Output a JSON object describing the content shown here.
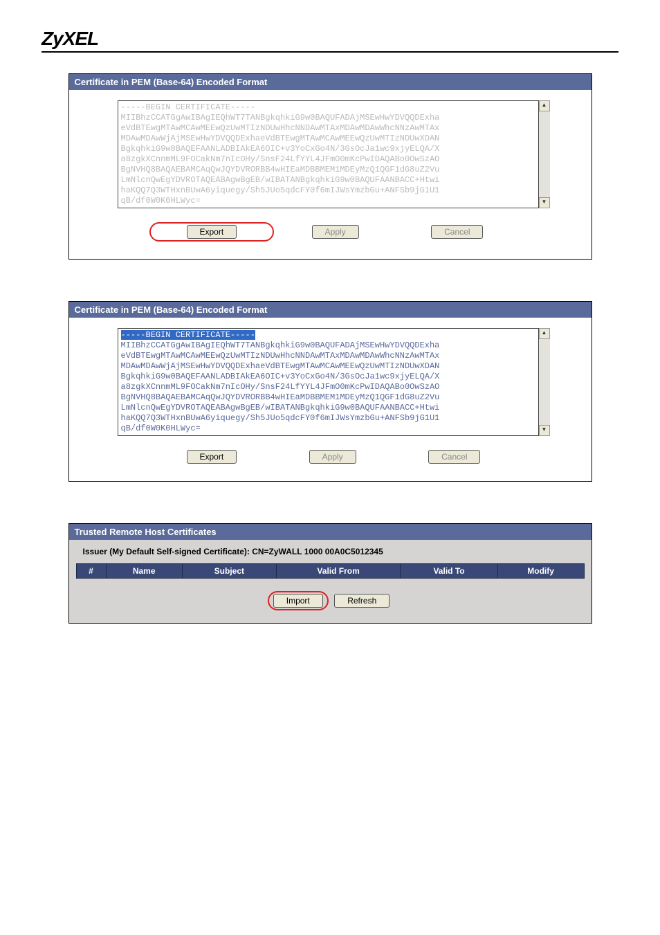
{
  "brand": "ZyXEL",
  "panel1": {
    "header": "Certificate in PEM (Base-64) Encoded Format",
    "pem_first_line": "-----BEGIN CERTIFICATE-----",
    "pem_rest": "MIIBhzCCATGgAwIBAgIEQhWT7TANBgkqhkiG9w0BAQUFADAjMSEwHwYDVQQDExha\neVdBTEwgMTAwMCAwMEEwQzUwMTIzNDUwHhcNNDAwMTAxMDAwMDAwWhcNNzAwMTAx\nMDAwMDAwWjAjMSEwHwYDVQQDExhaeVdBTEwgMTAwMCAwMEEwQzUwMTIzNDUwXDAN\nBgkqhkiG9w0BAQEFAANLADBIAkEA6OIC+v3YoCxGo4N/3GsOcJa1wc9xjyELQA/X\na8zgkXCnnmML9FOCakNm7nIcOHy/SnsF24LfYYL4JFmO0mKcPwIDAQABo0OwSzAO\nBgNVHQ8BAQAEBAMCAqQwJQYDVRORBB4wHIEaMDBBMEM1MDEyMzQ1QGF1dG8uZ2Vu\nLmNlcnQwEgYDVROTAQEABAgwBgEB/wIBATANBgkqhkiG9w0BAQUFAANBACC+Htwi\nhaKQQ7Q3WTHxnBUwA6yiquegy/Sh5JUo5qdcFY0f6mIJWsYmzbGu+ANFSb9jG1U1\nqB/df0W0K0HLWyc=",
    "buttons": {
      "export": "Export",
      "apply": "Apply",
      "cancel": "Cancel"
    }
  },
  "panel2": {
    "header": "Certificate in PEM (Base-64) Encoded Format",
    "pem_first_line": "-----BEGIN CERTIFICATE-----",
    "pem_rest": "MIIBhzCCATGgAwIBAgIEQhWT7TANBgkqhkiG9w0BAQUFADAjMSEwHwYDVQQDExha\neVdBTEwgMTAwMCAwMEEwQzUwMTIzNDUwHhcNNDAwMTAxMDAwMDAwWhcNNzAwMTAx\nMDAwMDAwWjAjMSEwHwYDVQQDExhaeVdBTEwgMTAwMCAwMEEwQzUwMTIzNDUwXDAN\nBgkqhkiG9w0BAQEFAANLADBIAkEA6OIC+v3YoCxGo4N/3GsOcJa1wc9xjyELQA/X\na8zgkXCnnmML9FOCakNm7nIcOHy/SnsF24LfYYL4JFmO0mKcPwIDAQABo0OwSzAO\nBgNVHQ8BAQAEBAMCAqQwJQYDVRORBB4wHIEaMDBBMEM1MDEyMzQ1QGF1dG8uZ2Vu\nLmNlcnQwEgYDVROTAQEABAgwBgEB/wIBATANBgkqhkiG9w0BAQUFAANBACC+Htwi\nhaKQQ7Q3WTHxnBUwA6yiquegy/Sh5JUo5qdcFY0f6mIJWsYmzbGu+ANFSb9jG1U1\nqB/df0W0K0HLWyc=",
    "buttons": {
      "export": "Export",
      "apply": "Apply",
      "cancel": "Cancel"
    }
  },
  "panel3": {
    "header": "Trusted Remote Host Certificates",
    "issuer": "Issuer (My Default Self-signed Certificate): CN=ZyWALL 1000 00A0C5012345",
    "columns": {
      "num": "#",
      "name": "Name",
      "subject": "Subject",
      "valid_from": "Valid From",
      "valid_to": "Valid To",
      "modify": "Modify"
    },
    "buttons": {
      "import": "Import",
      "refresh": "Refresh"
    }
  }
}
